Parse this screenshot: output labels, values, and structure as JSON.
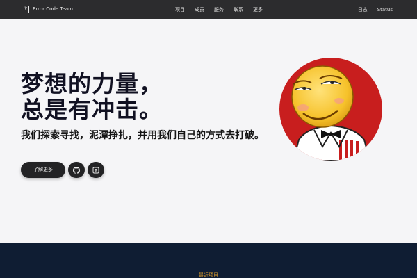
{
  "brand": {
    "logo_glyph": "ℛ",
    "name": "Error Code Team"
  },
  "nav": {
    "items": [
      "项目",
      "成员",
      "服务",
      "联系",
      "更多"
    ]
  },
  "nav_right": {
    "items": [
      "日志",
      "Status"
    ]
  },
  "hero": {
    "headline_line1": "梦想的力量，",
    "headline_line2": "总是有冲击。",
    "subline": "我们探索寻找，泥潭挣扎，并用我们自己的方式去打破。",
    "more_button": "了解更多",
    "github_icon": "github-icon",
    "blog_icon": "document-icon"
  },
  "bottom": {
    "section_title": "最近项目"
  },
  "colors": {
    "topbar": "#2c2c2e",
    "hero_bg": "#f5f5f7",
    "button_bg": "#232325",
    "bottom_bg": "#0f1d33",
    "accent": "#d99a2b",
    "avatar_red": "#c81e1e",
    "face_yellow": "#f7c531"
  }
}
